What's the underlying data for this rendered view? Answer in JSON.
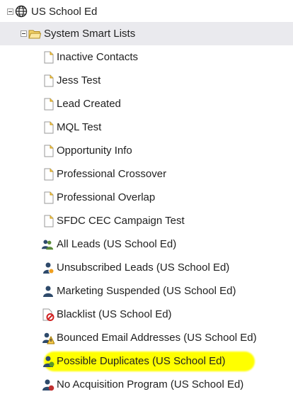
{
  "root": {
    "label": "US School Ed",
    "icon": "globe-icon"
  },
  "folder": {
    "label": "System Smart Lists",
    "icon": "folder-icon"
  },
  "items": [
    {
      "label": "Inactive Contacts",
      "icon": "smart-list-icon"
    },
    {
      "label": "Jess Test",
      "icon": "smart-list-icon"
    },
    {
      "label": "Lead Created",
      "icon": "smart-list-icon"
    },
    {
      "label": "MQL Test",
      "icon": "smart-list-icon"
    },
    {
      "label": "Opportunity Info",
      "icon": "smart-list-icon"
    },
    {
      "label": "Professional Crossover",
      "icon": "smart-list-icon"
    },
    {
      "label": "Professional Overlap",
      "icon": "smart-list-icon"
    },
    {
      "label": "SFDC CEC Campaign Test",
      "icon": "smart-list-icon"
    },
    {
      "label": "All Leads (US School Ed)",
      "icon": "people-icon"
    },
    {
      "label": "Unsubscribed Leads (US School Ed)",
      "icon": "person-unsubscribed-icon"
    },
    {
      "label": "Marketing Suspended (US School Ed)",
      "icon": "person-suspended-icon"
    },
    {
      "label": "Blacklist (US School Ed)",
      "icon": "blacklist-icon"
    },
    {
      "label": "Bounced Email Addresses (US School Ed)",
      "icon": "warning-icon"
    },
    {
      "label": "Possible Duplicates (US School Ed)",
      "icon": "person-duplicate-icon"
    },
    {
      "label": "No Acquisition Program (US School Ed)",
      "icon": "person-no-program-icon"
    }
  ],
  "highlighted_item": "Possible Duplicates (US School Ed)"
}
